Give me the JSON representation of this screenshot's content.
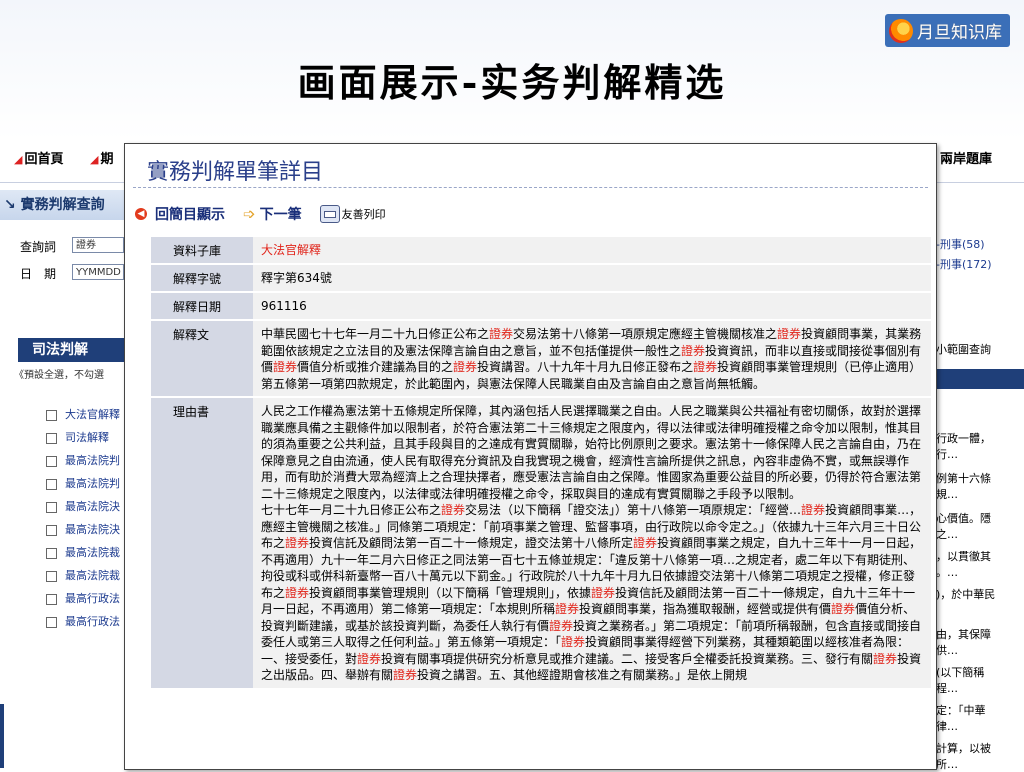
{
  "slide": {
    "title": "画面展示-实务判解精选",
    "logo_text": "月旦知识库",
    "logo_icon": "orange-swirl-icon"
  },
  "background_page": {
    "nav": [
      {
        "label": "回首頁"
      },
      {
        "label": "期"
      },
      {
        "label": "兩岸題庫"
      }
    ],
    "search_panel": {
      "header": "實務判解查詢",
      "query_label": "查詢詞",
      "query_value": "證券",
      "date_label": "日　期",
      "date_placeholder": "YYMMDD"
    },
    "judicial_section": {
      "title": "司法判解",
      "tip": "《預設全選，不勾選",
      "items": [
        {
          "label": "大法官解釋"
        },
        {
          "label": "司法解釋"
        },
        {
          "label": "最高法院判"
        },
        {
          "label": "最高法院判"
        },
        {
          "label": "最高法院決"
        },
        {
          "label": "最高法院決"
        },
        {
          "label": "最高法院裁"
        },
        {
          "label": "最高法院裁"
        },
        {
          "label": "最高行政法"
        },
        {
          "label": "最高行政法"
        }
      ]
    },
    "right_column": [
      {
        "text": "-刑事(58)",
        "link": true
      },
      {
        "text": "-刑事(172)",
        "link": true
      },
      {
        "text": "小範圍查詢",
        "link": false
      },
      {
        "text": "條第一項原",
        "link": false
      },
      {
        "text": "行政一體，",
        "link": false
      },
      {
        "text": "行…",
        "link": false
      },
      {
        "text": "例第十六條",
        "link": false
      },
      {
        "text": "規…",
        "link": false
      },
      {
        "text": "心價值。隱",
        "link": false
      },
      {
        "text": "之…",
        "link": false
      },
      {
        "text": "，以貫徹其",
        "link": false
      },
      {
        "text": "。…",
        "link": false
      },
      {
        "text": ")，於中華民",
        "link": false
      },
      {
        "text": "由，其保障",
        "link": false
      },
      {
        "text": "供…",
        "link": false
      },
      {
        "text": "(以下簡稱",
        "link": false
      },
      {
        "text": "程…",
        "link": false
      },
      {
        "text": "定：「中華",
        "link": false
      },
      {
        "text": "律…",
        "link": false
      },
      {
        "text": "計算，以被",
        "link": false
      },
      {
        "text": "所…",
        "link": false
      }
    ]
  },
  "popup": {
    "title": "實務判解單筆詳目",
    "toolbar": {
      "back_label": "回簡目顯示",
      "next_label": "下一筆",
      "print_label": "友善列印"
    },
    "fields": [
      {
        "key": "資料子庫",
        "value_parts": [
          {
            "t": "大法官解釋",
            "hl": true
          }
        ]
      },
      {
        "key": "解釋字號",
        "value_parts": [
          {
            "t": "釋字第634號",
            "hl": false
          }
        ]
      },
      {
        "key": "解釋日期",
        "value_parts": [
          {
            "t": "961116",
            "hl": false
          }
        ]
      },
      {
        "key": "解釋文",
        "value_parts": [
          {
            "t": "中華民國七十七年一月二十九日修正公布之",
            "hl": false
          },
          {
            "t": "證券",
            "hl": true
          },
          {
            "t": "交易法第十八條第一項原規定應經主管機關核准之",
            "hl": false
          },
          {
            "t": "證券",
            "hl": true
          },
          {
            "t": "投資顧問事業，其業務範圍依該規定之立法目的及憲法保障言論自由之意旨，並不包括僅提供一般性之",
            "hl": false
          },
          {
            "t": "證券",
            "hl": true
          },
          {
            "t": "投資資訊，而非以直接或間接從事個別有價",
            "hl": false
          },
          {
            "t": "證券",
            "hl": true
          },
          {
            "t": "價值分析或推介建議為目的之",
            "hl": false
          },
          {
            "t": "證券",
            "hl": true
          },
          {
            "t": "投資講習。八十九年十月九日修正發布之",
            "hl": false
          },
          {
            "t": "證券",
            "hl": true
          },
          {
            "t": "投資顧問事業管理規則（已停止適用）第五條第一項第四款規定，於此範圍內，與憲法保障人民職業自由及言論自由之意旨尚無牴觸。",
            "hl": false
          }
        ]
      },
      {
        "key": "理由書",
        "value_parts": [
          {
            "t": "人民之工作權為憲法第十五條規定所保障，其內涵包括人民選擇職業之自由。人民之職業與公共福祉有密切關係，故對於選擇職業應具備之主觀條件加以限制者，於符合憲法第二十三條規定之限度內，得以法律或法律明確授權之命令加以限制，惟其目的須為重要之公共利益，且其手段與目的之達成有實質關聯，始符比例原則之要求。憲法第十一條保障人民之言論自由，乃在保障意見之自由流通，使人民有取得充分資訊及自我實現之機會，經濟性言論所提供之訊息，內容非虛偽不實，或無誤導作用，而有助於消費大眾為經濟上之合理抉擇者，應受憲法言論自由之保障。惟國家為重要公益目的所必要，仍得於符合憲法第二十三條規定之限度內，以法律或法律明確授權之命令，採取與目的達成有實質關聯之手段予以限制。",
            "hl": false
          },
          {
            "t": "\n七十七年一月二十九日修正公布之",
            "hl": false
          },
          {
            "t": "證券",
            "hl": true
          },
          {
            "t": "交易法（以下簡稱「證交法」）第十八條第一項原規定：「經營…",
            "hl": false
          },
          {
            "t": "證券",
            "hl": true
          },
          {
            "t": "投資顧問事業…，應經主管機關之核准。」同條第二項規定：「前項事業之管理、監督事項，由行政院以命令定之。」（依據九十三年六月三十日公布之",
            "hl": false
          },
          {
            "t": "證券",
            "hl": true
          },
          {
            "t": "投資信託及顧問法第一百二十一條規定，證交法第十八條所定",
            "hl": false
          },
          {
            "t": "證券",
            "hl": true
          },
          {
            "t": "投資顧問事業之規定，自九十三年十一月一日起，不再適用）九十一年二月六日修正之同法第一百七十五條並規定：「違反第十八條第一項…之規定者，處二年以下有期徒刑、拘役或科或併科新臺幣一百八十萬元以下罰金。」行政院於八十九年十月九日依據證交法第十八條第二項規定之授權，修正發布之",
            "hl": false
          },
          {
            "t": "證券",
            "hl": true
          },
          {
            "t": "投資顧問事業管理規則（以下簡稱「管理規則」，依據",
            "hl": false
          },
          {
            "t": "證券",
            "hl": true
          },
          {
            "t": "投資信託及顧問法第一百二十一條規定，自九十三年十一月一日起，不再適用）第二條第一項規定：「本規則所稱",
            "hl": false
          },
          {
            "t": "證券",
            "hl": true
          },
          {
            "t": "投資顧問事業，指為獲取報酬，經營或提供有價",
            "hl": false
          },
          {
            "t": "證券",
            "hl": true
          },
          {
            "t": "價值分析、投資判斷建議，或基於該投資判斷，為委任人執行有價",
            "hl": false
          },
          {
            "t": "證券",
            "hl": true
          },
          {
            "t": "投資之業務者。」第二項規定：「前項所稱報酬，包含直接或間接自委任人或第三人取得之任何利益。」第五條第一項規定：「",
            "hl": false
          },
          {
            "t": "證券",
            "hl": true
          },
          {
            "t": "投資顧問事業得經營下列業務，其種類範圍以經核准者為限：一、接受委任，對",
            "hl": false
          },
          {
            "t": "證券",
            "hl": true
          },
          {
            "t": "投資有關事項提供研究分析意見或推介建議。二、接受客戶全權委託投資業務。三、發行有關",
            "hl": false
          },
          {
            "t": "證券",
            "hl": true
          },
          {
            "t": "投資之出版品。四、舉辦有關",
            "hl": false
          },
          {
            "t": "證券",
            "hl": true
          },
          {
            "t": "投資之講習。五、其他經證期會核准之有關業務。」是依上開規",
            "hl": false
          }
        ]
      }
    ]
  }
}
